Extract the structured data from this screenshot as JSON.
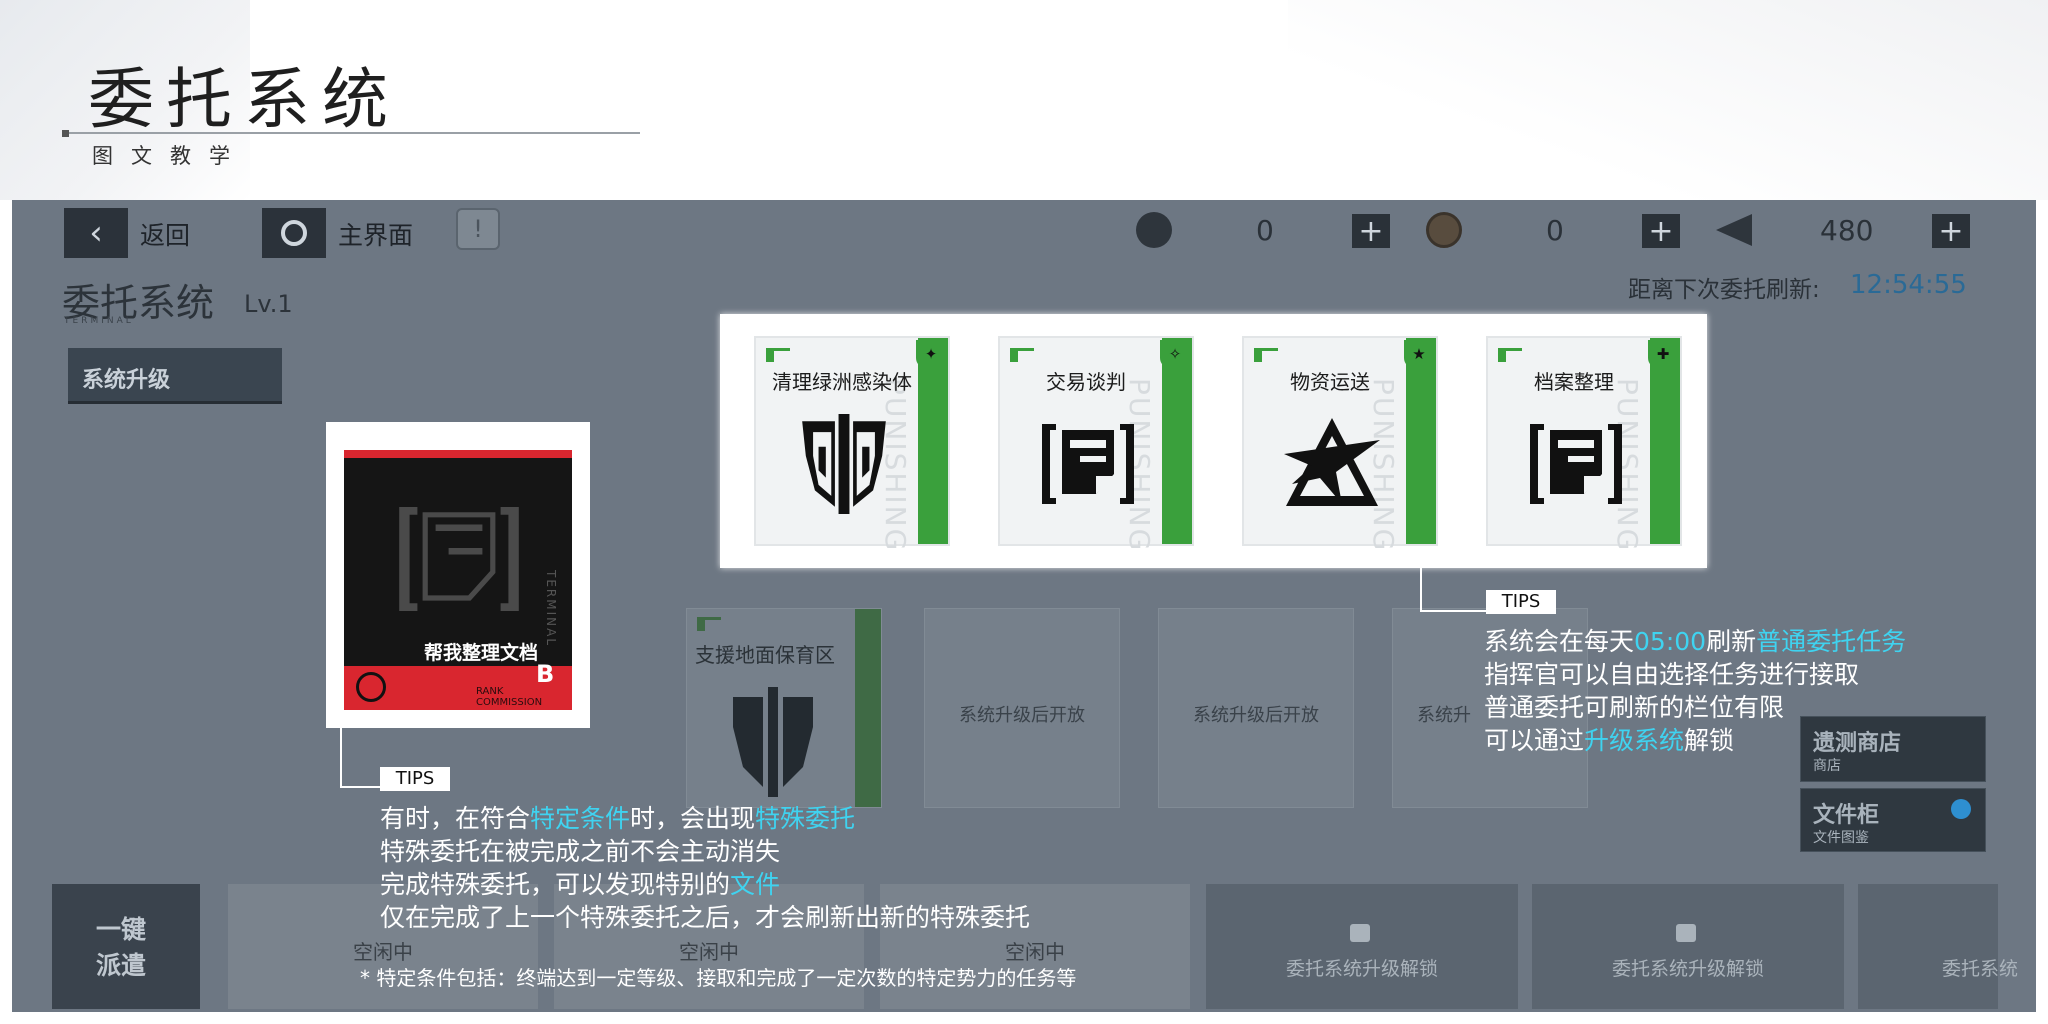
{
  "header": {
    "title": "委托系统",
    "subtitle": "图文教学"
  },
  "topbar": {
    "back_label": "返回",
    "home_label": "主界面",
    "resources": [
      {
        "icon": "hex-nut-icon",
        "value": "0"
      },
      {
        "icon": "coin-icon",
        "value": "0"
      },
      {
        "icon": "paper-plane-icon",
        "value": "480"
      }
    ],
    "plus_label": "+"
  },
  "system": {
    "title": "委托系统",
    "level": "Lv.1",
    "terminal": "TERMINAL",
    "refresh_label": "距离下次委托刷新:",
    "refresh_time": "12:54:55",
    "upgrade_label": "系统升级"
  },
  "grid": {
    "special_slot_title": "支援地面保育区",
    "locked_label": "系统升级后开放",
    "locked_label_truncated": "系统升"
  },
  "side_buttons": [
    {
      "title": "遗测商店",
      "sub": "商店"
    },
    {
      "title": "文件柜",
      "sub": "文件图鉴"
    }
  ],
  "bottom": {
    "dispatch_line1": "一键",
    "dispatch_line2": "派遣",
    "idle_label": "空闲中",
    "lock_label": "委托系统升级解锁",
    "lock_label_truncated": "委托系统"
  },
  "commission_cards": [
    {
      "title": "清理绿洲感染体",
      "icon": "shield-emblem-icon",
      "vtext": "PUNISHING"
    },
    {
      "title": "交易谈判",
      "icon": "document-bracket-icon",
      "vtext": "PUNISHING"
    },
    {
      "title": "物资运送",
      "icon": "star-triangle-icon",
      "vtext": "PUNISHING"
    },
    {
      "title": "档案整理",
      "icon": "document-bracket-icon",
      "vtext": "PUNISHING"
    }
  ],
  "special_card": {
    "title": "帮我整理文档",
    "rank": "B",
    "rank_label1": "RANK",
    "rank_label2": "COMMISSION",
    "vtext": "TERMINAL"
  },
  "tips_label": "TIPS",
  "tip_right": [
    [
      {
        "t": "系统会在每天",
        "h": false
      },
      {
        "t": "05:00",
        "h": true
      },
      {
        "t": "刷新",
        "h": false
      },
      {
        "t": "普通委托任务",
        "h": true
      }
    ],
    [
      {
        "t": "指挥官可以自由选择任务进行接取",
        "h": false
      }
    ],
    [
      {
        "t": "普通委托可刷新的栏位有限",
        "h": false
      }
    ],
    [
      {
        "t": "可以通过",
        "h": false
      },
      {
        "t": "升级系统",
        "h": true
      },
      {
        "t": "解锁",
        "h": false
      }
    ]
  ],
  "tip_left": [
    [
      {
        "t": "有时，在符合",
        "h": false
      },
      {
        "t": "特定条件",
        "h": true
      },
      {
        "t": "时，会出现",
        "h": false
      },
      {
        "t": "特殊委托",
        "h": true
      }
    ],
    [
      {
        "t": "特殊委托在被完成之前不会主动消失",
        "h": false
      }
    ],
    [
      {
        "t": "完成特殊委托，可以发现特别的",
        "h": false
      },
      {
        "t": "文件",
        "h": true
      }
    ],
    [
      {
        "t": "仅在完成了上一个特殊委托之后，才会刷新出新的特殊委托",
        "h": false
      }
    ]
  ],
  "footnote": "* 特定条件包括：终端达到一定等级、接取和完成了一定次数的特定势力的任务等",
  "colors": {
    "highlight": "#3fd3f0",
    "green": "#3aa03c",
    "overlay": "#6d7783"
  }
}
